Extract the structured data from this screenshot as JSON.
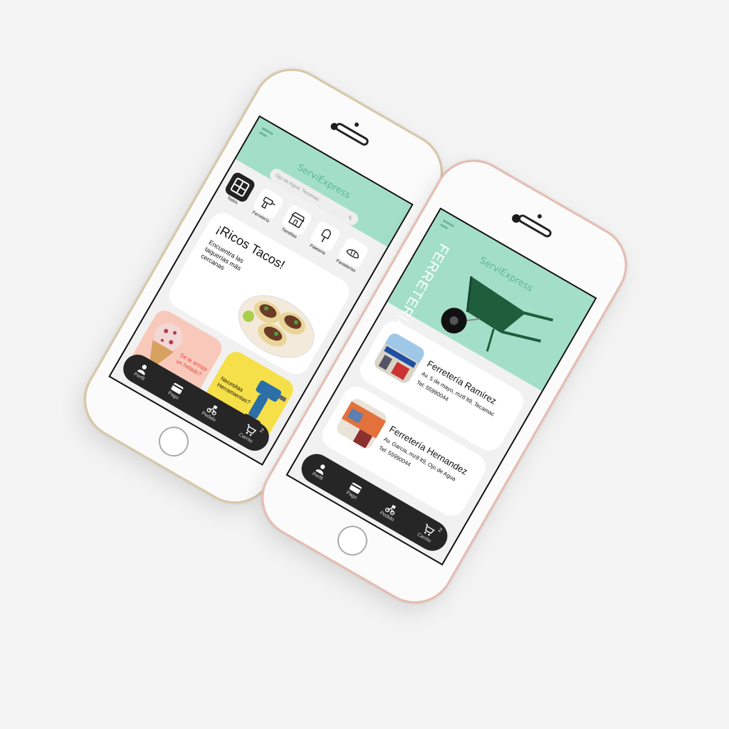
{
  "app": {
    "brand": "ServiExpress"
  },
  "phone_left": {
    "location": "Ojo de Agua, Tecamac",
    "categories": [
      {
        "label": "Todos",
        "icon": "grid-icon",
        "selected": true
      },
      {
        "label": "Ferretería",
        "icon": "drill-icon",
        "selected": false
      },
      {
        "label": "Tienditas",
        "icon": "store-icon",
        "selected": false
      },
      {
        "label": "Paletería",
        "icon": "popsicle-icon",
        "selected": false
      },
      {
        "label": "Panaderías",
        "icon": "bread-icon",
        "selected": false
      }
    ],
    "promo_tacos": {
      "title": "¡Ricos Tacos!",
      "subtitle": "Encuentra las taquerías más cercanas"
    },
    "promo_icecream": {
      "text": "Se te antoja un helado?"
    },
    "promo_tools": {
      "text": "Necesitas Herramientas?"
    }
  },
  "phone_right": {
    "banner_title": "FERRETERIAS",
    "stores": [
      {
        "name": "Ferretería Ramírez",
        "address": "Av. 5 de mayo, mz8 lt9, Tecamac",
        "phone": "Tel: 55990044"
      },
      {
        "name": "Ferretería Hernandez",
        "address": "Av. Garcia, mz8 lt9, Ojo de Agua",
        "phone": "Tel: 55990044"
      }
    ]
  },
  "nav": {
    "items": [
      {
        "label": "Perfil",
        "icon": "person-icon"
      },
      {
        "label": "Pago",
        "icon": "card-icon"
      },
      {
        "label": "Pedido",
        "icon": "delivery-icon"
      },
      {
        "label": "Carrito",
        "icon": "cart-icon"
      }
    ],
    "cart_count": "2"
  },
  "colors": {
    "header": "#a3dfc8",
    "brand": "#5ab894",
    "nav": "#262626",
    "gold_frame": "#d8c6a7",
    "rose_frame": "#e5bcb0"
  }
}
